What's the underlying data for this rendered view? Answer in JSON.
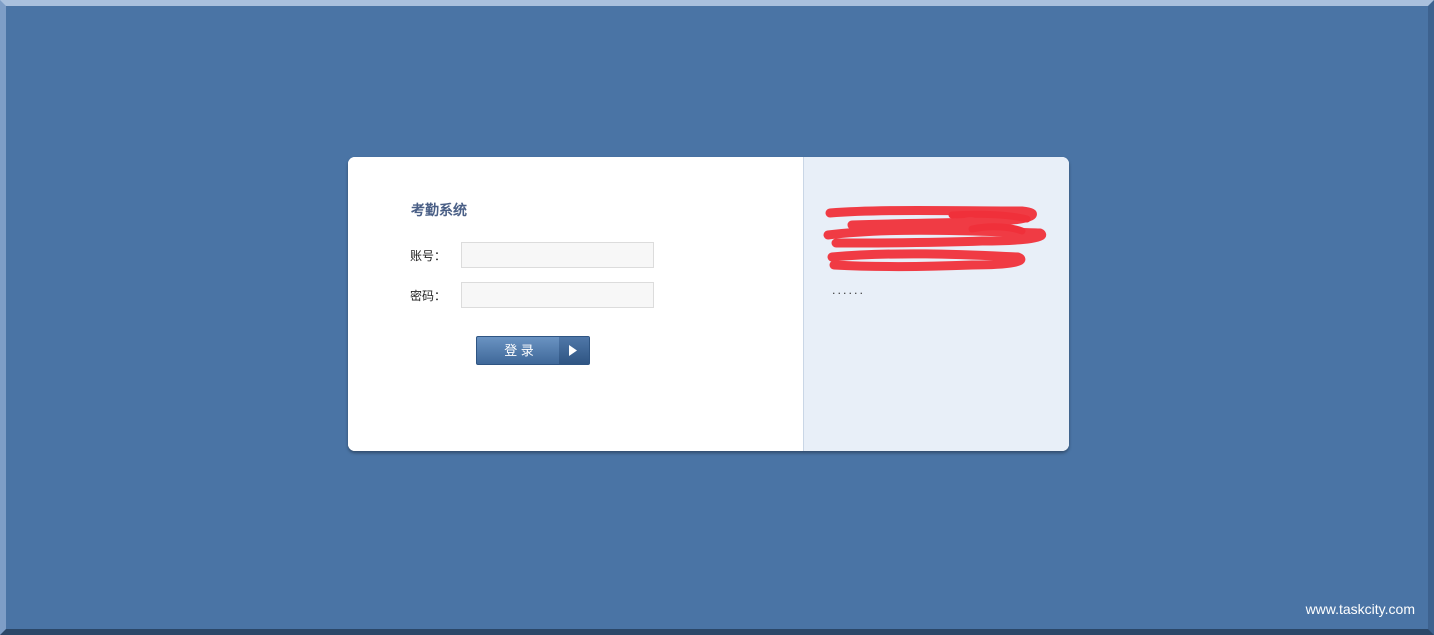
{
  "login": {
    "title": "考勤系统",
    "account_label": "账号：",
    "account_value": "",
    "password_label": "密码：",
    "password_value": "",
    "submit_label": "登 录"
  },
  "notice": {
    "lines": [
      "",
      "",
      ""
    ],
    "more": "......"
  },
  "footer": {
    "site": "www.taskcity.com"
  },
  "colors": {
    "background": "#4a74a5",
    "panel": "#e8eff8",
    "title": "#4a5f86",
    "button": "#3f6899",
    "redaction": "#f0303a"
  }
}
